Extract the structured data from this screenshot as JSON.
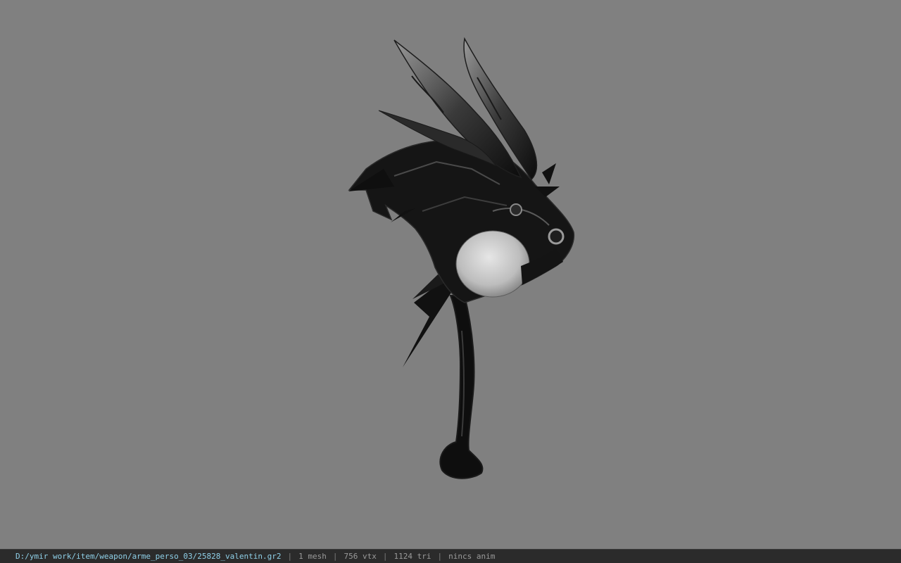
{
  "viewport": {
    "background_color": "#808080",
    "model_description_icon": "dragon-head-axe-model"
  },
  "statusbar": {
    "path": "D:/ymir work/item/weapon/arme_perso_03/25828_valentin.gr2",
    "separator": "|",
    "mesh": "1 mesh",
    "vtx": "756 vtx",
    "tri": "1124 tri",
    "anim": "nincs anim"
  },
  "colors": {
    "status_bg": "#2b2b2b",
    "path_text": "#8fd0e8",
    "status_text": "#9a9a9a"
  }
}
